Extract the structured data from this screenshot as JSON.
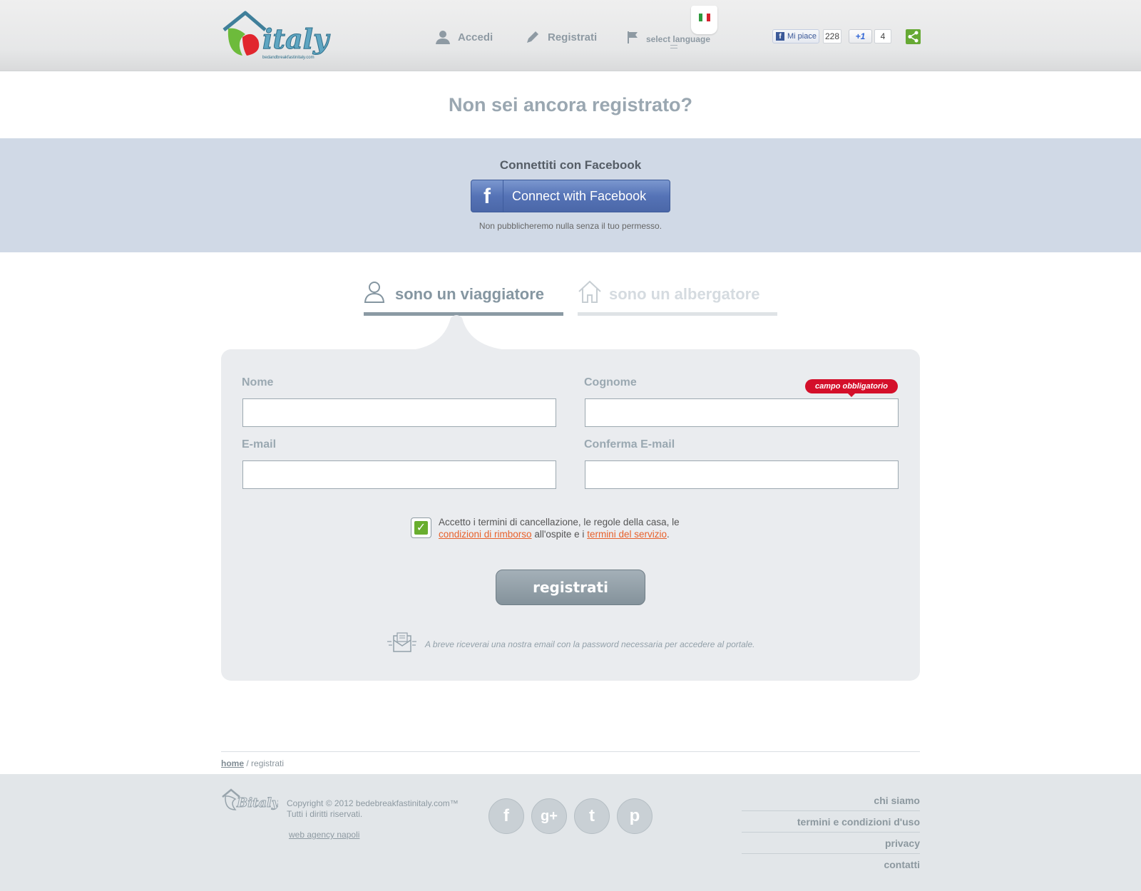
{
  "header": {
    "logo_text": "Bitaly",
    "logo_subtext": "bedandbreakfastinitaly.com",
    "nav": {
      "login_label": "Accedi",
      "register_label": "Registrati",
      "language_label": "select language"
    },
    "social": {
      "fb_like_label": "Mi piace",
      "fb_like_count": "228",
      "gplus_label": "+1",
      "gplus_count": "4"
    }
  },
  "main": {
    "title": "Non sei ancora registrato?",
    "facebook": {
      "heading": "Connettiti con Facebook",
      "button_label": "Connect with Facebook",
      "button_icon": "f",
      "note": "Non pubblicheremo nulla senza il tuo permesso."
    },
    "tabs": [
      {
        "label": "sono un viaggiatore",
        "icon": "traveler-icon",
        "active": true
      },
      {
        "label": "sono un albergatore",
        "icon": "house-icon",
        "active": false
      }
    ],
    "form": {
      "first_name_label": "Nome",
      "first_name_value": "",
      "last_name_label": "Cognome",
      "last_name_value": "",
      "required_badge": "campo obbligatorio",
      "email_label": "E-mail",
      "email_value": "",
      "confirm_email_label": "Conferma E-mail",
      "confirm_email_value": "",
      "terms_checked": true,
      "terms_text_1": "Accetto i termini di cancellazione, le regole della casa, le",
      "terms_link_1": "condizioni di rimborso",
      "terms_text_2": " all'ospite e i ",
      "terms_link_2": "termini del servizio",
      "terms_text_3": ".",
      "submit_label": "registrati",
      "mail_note": "A breve riceverai una nostra email con la password necessaria per accedere al portale."
    }
  },
  "breadcrumb": {
    "home": "home",
    "separator": " / ",
    "current": "registrati"
  },
  "footer": {
    "logo_text": "Bitaly",
    "copyright_line_1": "Copyright © 2012 bedebreakfastinitaly.com™",
    "copyright_line_2": "Tutti i diritti riservati.",
    "agency": "web agency napoli",
    "social_icons": [
      "facebook-icon",
      "google-plus-icon",
      "twitter-icon",
      "pinterest-icon"
    ],
    "social_glyphs": [
      "f",
      "g+",
      "t",
      "p"
    ],
    "links": [
      "chi siamo",
      "termini e condizioni d'uso",
      "privacy",
      "contatti"
    ]
  },
  "colors": {
    "accent_red": "#d40f2a",
    "link_orange": "#e8612b",
    "facebook_blue": "#5573b6",
    "check_green": "#69ae2f",
    "share_green": "#66a934"
  }
}
